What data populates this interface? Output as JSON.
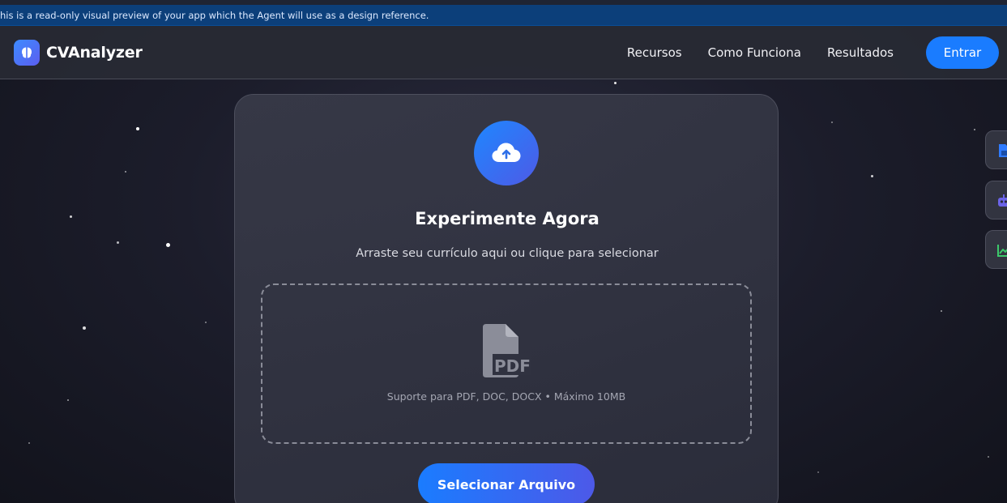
{
  "preview_banner": {
    "text": "his is a read-only visual preview of your app which the Agent will use as a design reference."
  },
  "brand": {
    "name": "CVAnalyzer",
    "logo_icon": "brain-icon"
  },
  "nav": {
    "links": [
      "Recursos",
      "Como Funciona",
      "Resultados"
    ],
    "login_label": "Entrar"
  },
  "card": {
    "upload_icon": "cloud-upload-icon",
    "title": "Experimente Agora",
    "subtitle": "Arraste seu currículo aqui ou clique para selecionar",
    "dropzone": {
      "file_icon": "pdf-file-icon",
      "file_icon_text": "PDF",
      "hint": "Suporte para PDF, DOC, DOCX • Máximo 10MB"
    },
    "button_label": "Selecionar Arquivo"
  },
  "side_dock": {
    "buttons": [
      {
        "icon": "file-icon",
        "color": "#2f7bff"
      },
      {
        "icon": "robot-icon",
        "color": "#6b63e6"
      },
      {
        "icon": "chart-line-icon",
        "color": "#3cc96b"
      }
    ]
  },
  "colors": {
    "accent": "#1a7cff",
    "accent_secondary": "#4d59e8",
    "banner": "#0c3f7a",
    "background": "#1c1d2b"
  }
}
